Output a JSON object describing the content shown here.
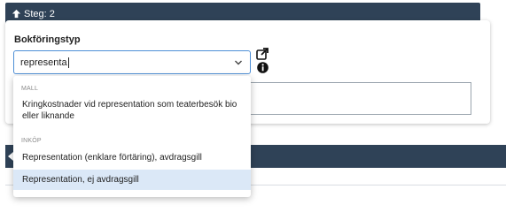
{
  "step": {
    "label": "Steg: 2"
  },
  "form": {
    "field_label": "Bokföringstyp",
    "select_value": "representa"
  },
  "dropdown": {
    "groups": [
      {
        "label": "MALL",
        "items": [
          {
            "label": "Kringkostnader vid representation som teaterbesök bio eller liknande"
          }
        ]
      },
      {
        "label": "INKÖP",
        "items": [
          {
            "label": "Representation (enklare förtäring), avdragsgill"
          },
          {
            "label": "Representation, ej avdragsgill"
          }
        ]
      }
    ]
  },
  "icons": {
    "step_arrow": "arrow-up-icon",
    "dropdown": "chevron-down-icon",
    "external": "external-link-icon",
    "info": "info-circle-icon",
    "collapse": "arrow-left-icon"
  },
  "colors": {
    "header_bg": "#2f4257",
    "focus_border": "#4e8fd6",
    "highlight": "#dbe8f7"
  }
}
